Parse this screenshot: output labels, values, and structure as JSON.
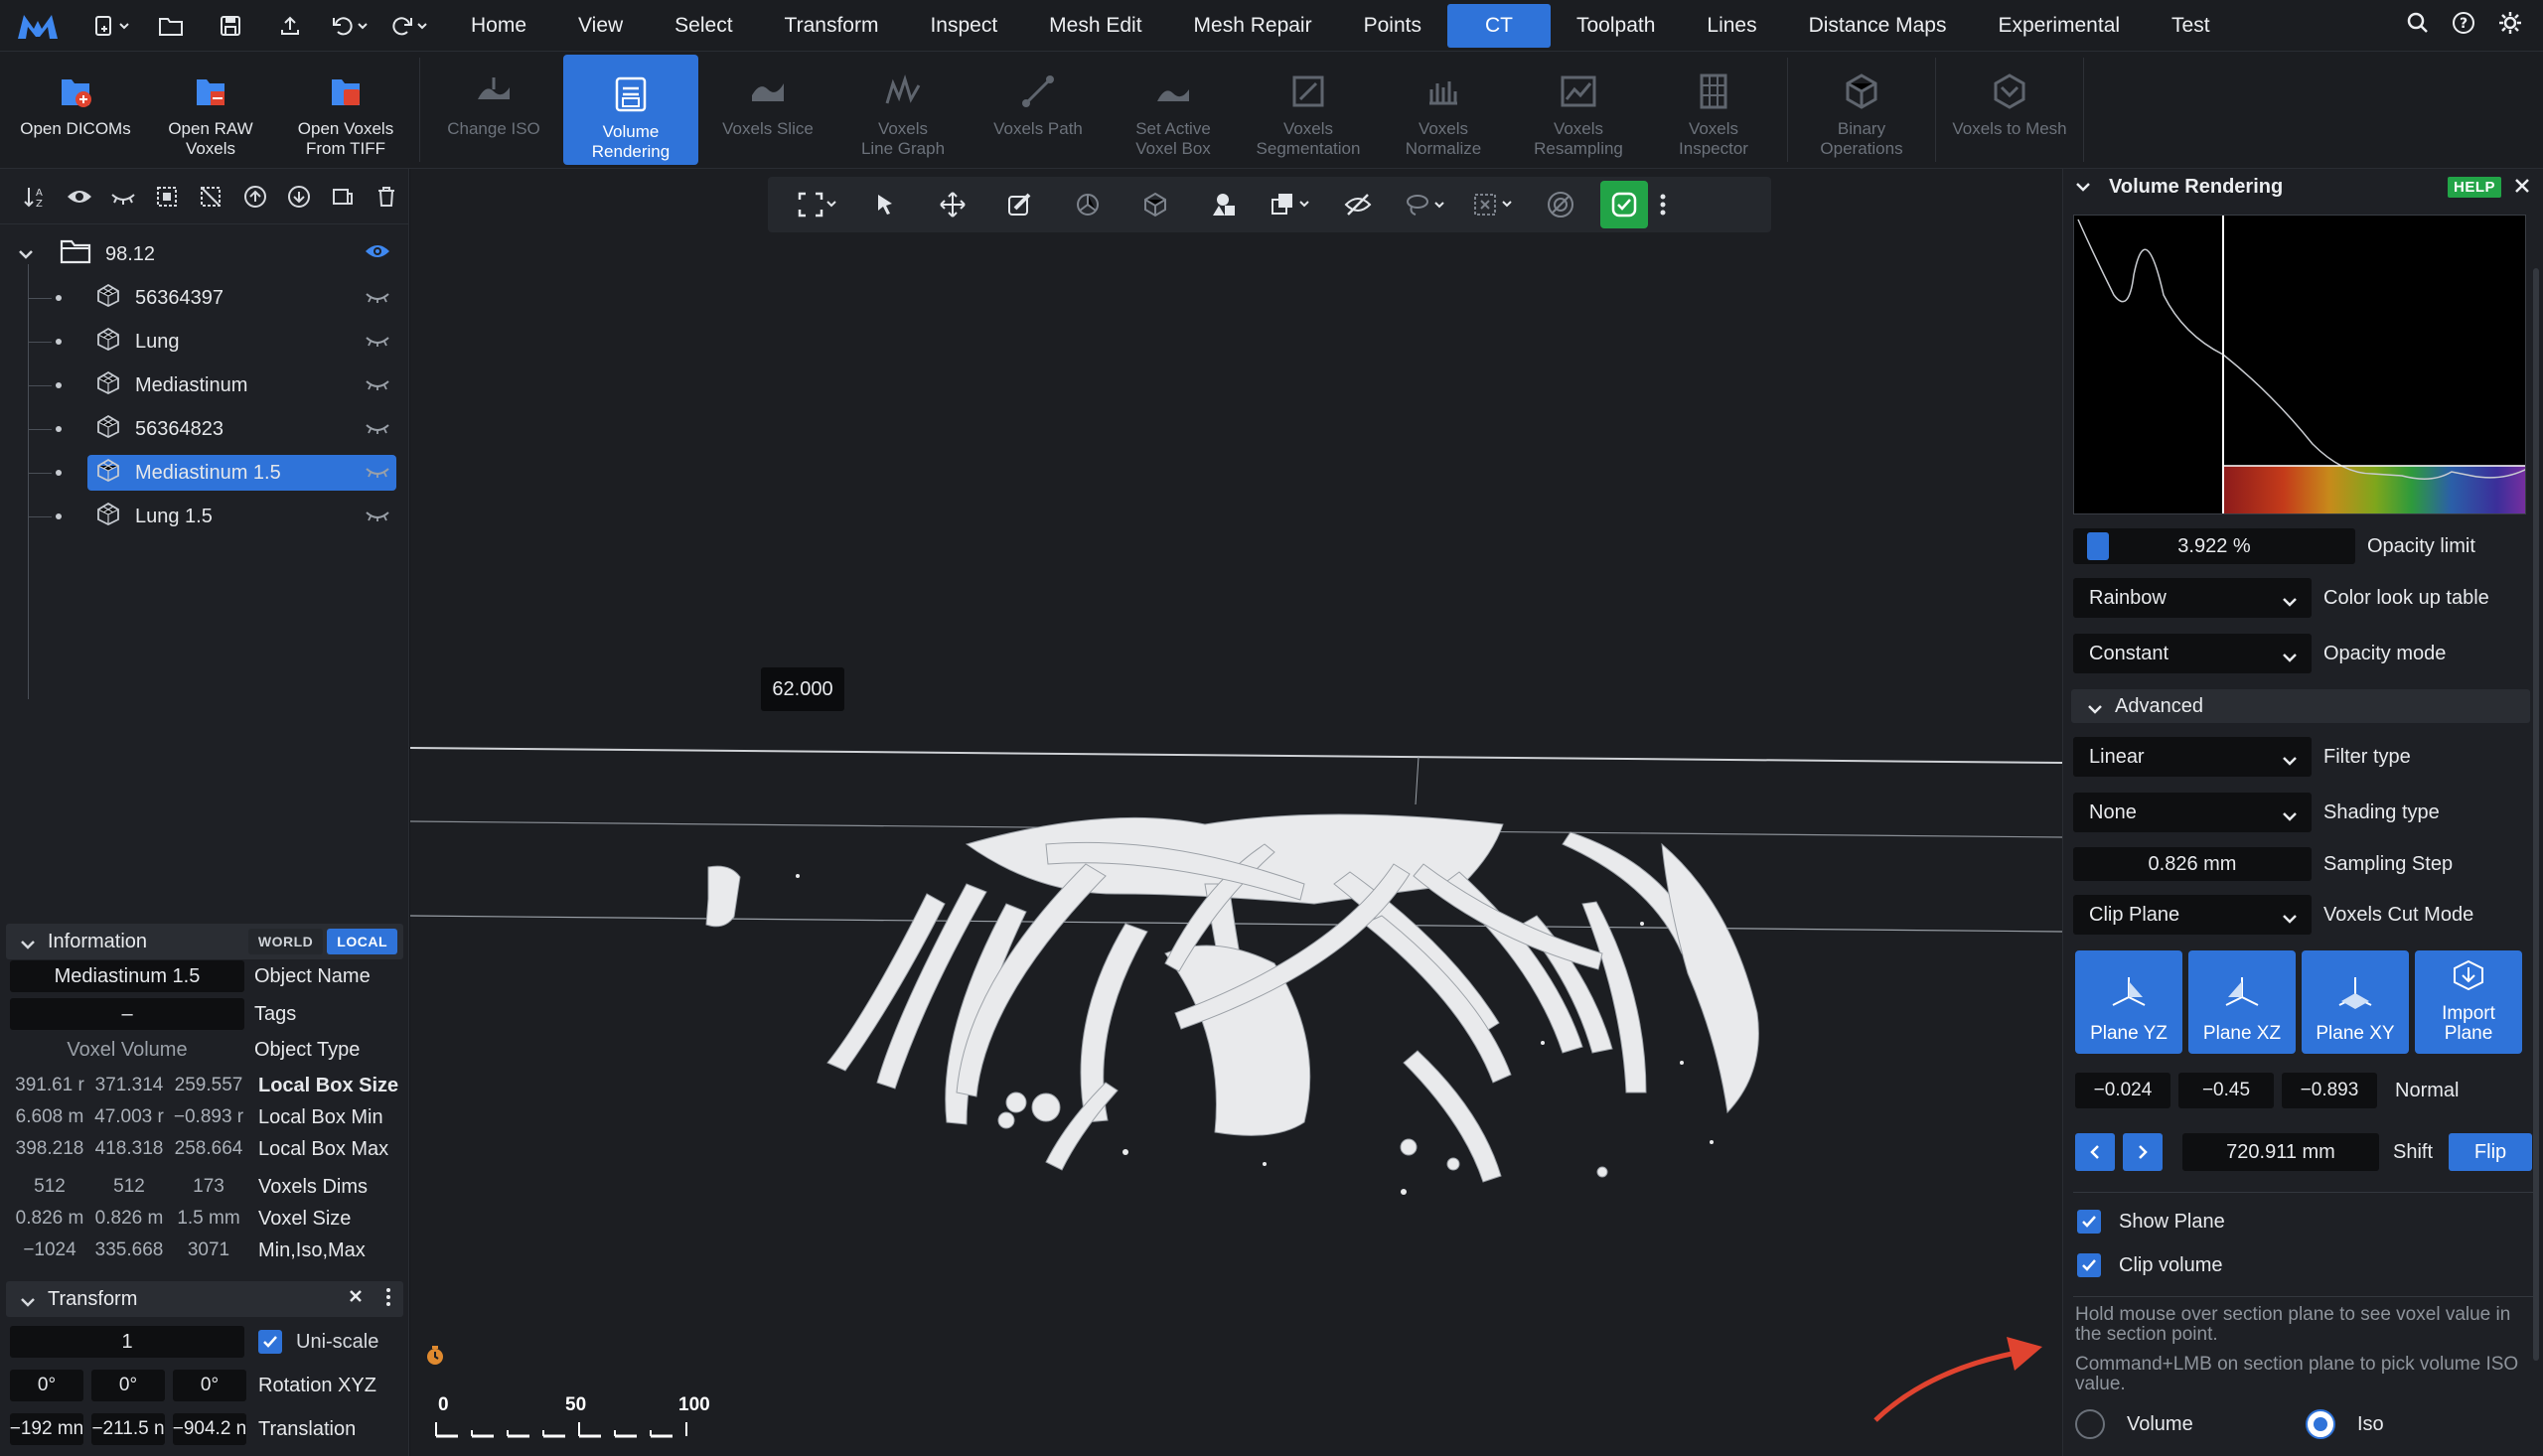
{
  "colors": {
    "accent": "#2f73d9",
    "help_green": "#22a447",
    "arrow_red": "#e0432f"
  },
  "menubar": {
    "items": [
      "Home",
      "View",
      "Select",
      "Transform",
      "Inspect",
      "Mesh Edit",
      "Mesh Repair",
      "Points",
      "CT",
      "Toolpath",
      "Lines",
      "Distance Maps",
      "Experimental",
      "Test"
    ],
    "active": "CT",
    "right_icons": [
      "search-icon",
      "help-icon",
      "gear-icon"
    ]
  },
  "ribbon": {
    "open_dicoms": "Open DICOMs",
    "open_raw_voxels": [
      "Open RAW",
      "Voxels"
    ],
    "open_voxels_tiff": [
      "Open Voxels",
      "From TIFF"
    ],
    "change_iso": "Change ISO",
    "volume_rendering": [
      "Volume",
      "Rendering"
    ],
    "voxels_slice": "Voxels Slice",
    "voxels_line_graph": [
      "Voxels",
      "Line Graph"
    ],
    "voxels_path": "Voxels Path",
    "set_active_voxel_box": [
      "Set Active",
      "Voxel Box"
    ],
    "voxels_segmentation": [
      "Voxels",
      "Segmentation"
    ],
    "voxels_normalize": [
      "Voxels",
      "Normalize"
    ],
    "voxels_resampling": [
      "Voxels",
      "Resampling"
    ],
    "voxels_inspector": [
      "Voxels",
      "Inspector"
    ],
    "binary_operations": [
      "Binary",
      "Operations"
    ],
    "voxels_to_mesh": "Voxels to Mesh"
  },
  "tree": {
    "folder": "98.12",
    "items": [
      "56364397",
      "Lung",
      "Mediastinum",
      "56364823",
      "Mediastinum 1.5",
      "Lung 1.5"
    ],
    "selected": "Mediastinum 1.5"
  },
  "information": {
    "header": "Information",
    "world": "WORLD",
    "local": "LOCAL",
    "object_name": {
      "value": "Mediastinum 1.5",
      "label": "Object Name"
    },
    "tags": {
      "value": "–",
      "label": "Tags"
    },
    "object_type": {
      "value": "Voxel Volume",
      "label": "Object Type"
    },
    "local_box_size": {
      "values": [
        "391.61 r",
        "371.314",
        "259.557"
      ],
      "label": "Local Box Size"
    },
    "local_box_min": {
      "values": [
        "6.608 m",
        "47.003 r",
        "−0.893 r"
      ],
      "label": "Local Box Min"
    },
    "local_box_max": {
      "values": [
        "398.218",
        "418.318",
        "258.664"
      ],
      "label": "Local Box Max"
    },
    "voxels_dims": {
      "values": [
        "512",
        "512",
        "173"
      ],
      "label": "Voxels Dims"
    },
    "voxel_size": {
      "values": [
        "0.826 m",
        "0.826 m",
        "1.5 mm"
      ],
      "label": "Voxel Size"
    },
    "min_iso_max": {
      "values": [
        "−1024",
        "335.668",
        "3071"
      ],
      "label": "Min,Iso,Max"
    }
  },
  "transform": {
    "header": "Transform",
    "scale": "1",
    "uniscale_label": "Uni-scale",
    "rotation": [
      "0°",
      "0°",
      "0°"
    ],
    "rotation_label": "Rotation XYZ",
    "translation": [
      "−192 mn",
      "−211.5 n",
      "−904.2 n"
    ],
    "translation_label": "Translation"
  },
  "viewport": {
    "tooltip": "62.000",
    "scale_labels": [
      "0",
      "50",
      "100"
    ]
  },
  "volume_rendering": {
    "title": "Volume Rendering",
    "help": "HELP",
    "opacity_limit": {
      "value": "3.922 %",
      "label": "Opacity limit",
      "fraction": 0.039
    },
    "color_lut": {
      "value": "Rainbow",
      "label": "Color look up table"
    },
    "opacity_mode": {
      "value": "Constant",
      "label": "Opacity mode"
    },
    "advanced": "Advanced",
    "filter_type": {
      "value": "Linear",
      "label": "Filter type"
    },
    "shading_type": {
      "value": "None",
      "label": "Shading type"
    },
    "sampling_step": {
      "value": "0.826 mm",
      "label": "Sampling Step"
    },
    "cut_mode": {
      "value": "Clip Plane",
      "label": "Voxels Cut Mode"
    },
    "plane_buttons": [
      [
        "Plane YZ"
      ],
      [
        "Plane XZ"
      ],
      [
        "Plane XY"
      ],
      [
        "Import",
        "Plane"
      ]
    ],
    "normal": {
      "values": [
        "−0.024",
        "−0.45",
        "−0.893"
      ],
      "label": "Normal"
    },
    "shift": {
      "value": "720.911 mm",
      "label": "Shift"
    },
    "flip": "Flip",
    "show_plane": "Show Plane",
    "clip_volume": "Clip volume",
    "hint1": "Hold mouse over section plane to see voxel value in the section point.",
    "hint2": "Command+LMB on section plane to pick volume ISO value.",
    "radio_volume": "Volume",
    "radio_iso": "Iso",
    "radio_selected": "Iso"
  }
}
